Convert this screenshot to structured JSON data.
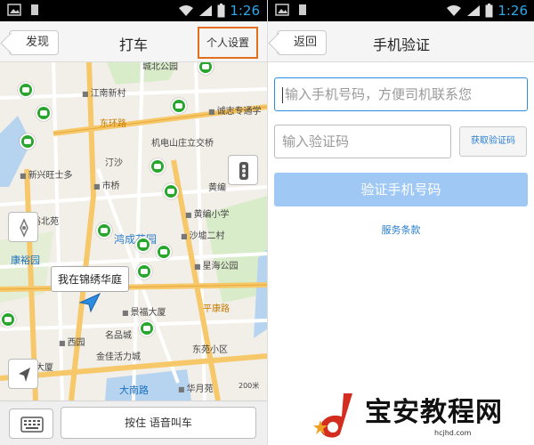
{
  "status_bar": {
    "time": "1:26"
  },
  "left_screen": {
    "nav": {
      "back_label": "发现",
      "title": "打车",
      "right_label": "个人设置"
    },
    "map": {
      "labels": {
        "jiangnan": "江南新村",
        "chengzhi": "诚志专通学",
        "dongkang": "东环路",
        "jidian": "机电山庄立交桥",
        "xinjian": "新兴旺士多",
        "shiqiao": "市桥",
        "tingsha": "汀沙",
        "huangbian": "黄编",
        "yubei": "裕北苑",
        "huangbianxiaoxue": "黄编小学",
        "hongcheng": "鸿成花园",
        "shaxu": "沙墟二村",
        "kangyu": "康裕园",
        "xingdao": "星海公园",
        "jingfu": "景福大厦",
        "pingkang": "平康路",
        "mingpin": "名品城",
        "xiyuan": "西园",
        "dongyuan": "东苑小区",
        "jinjia": "金佳活力城",
        "dasha": "大厦",
        "danan": "大南路",
        "huayue": "华月苑",
        "chengbei": "城北公园",
        "scale": "200米"
      },
      "location_bubble": "我在锦绣华庭"
    },
    "bottom": {
      "voice_label": "按住 语音叫车"
    }
  },
  "right_screen": {
    "nav": {
      "back_label": "返回",
      "title": "手机验证"
    },
    "phone_field": {
      "placeholder": "输入手机号码，方便司机联系您"
    },
    "code_field": {
      "placeholder": "输入验证码"
    },
    "get_code_label": "获取验证码",
    "verify_label": "验证手机号码",
    "terms_label": "服务条款"
  },
  "watermark": {
    "title": "宝安教程网",
    "url": "hcjhd.com"
  },
  "colors": {
    "accent": "#2c8de0",
    "highlight": "#e07020",
    "car": "#29a62d",
    "button_disabled": "#9fc9f4"
  }
}
